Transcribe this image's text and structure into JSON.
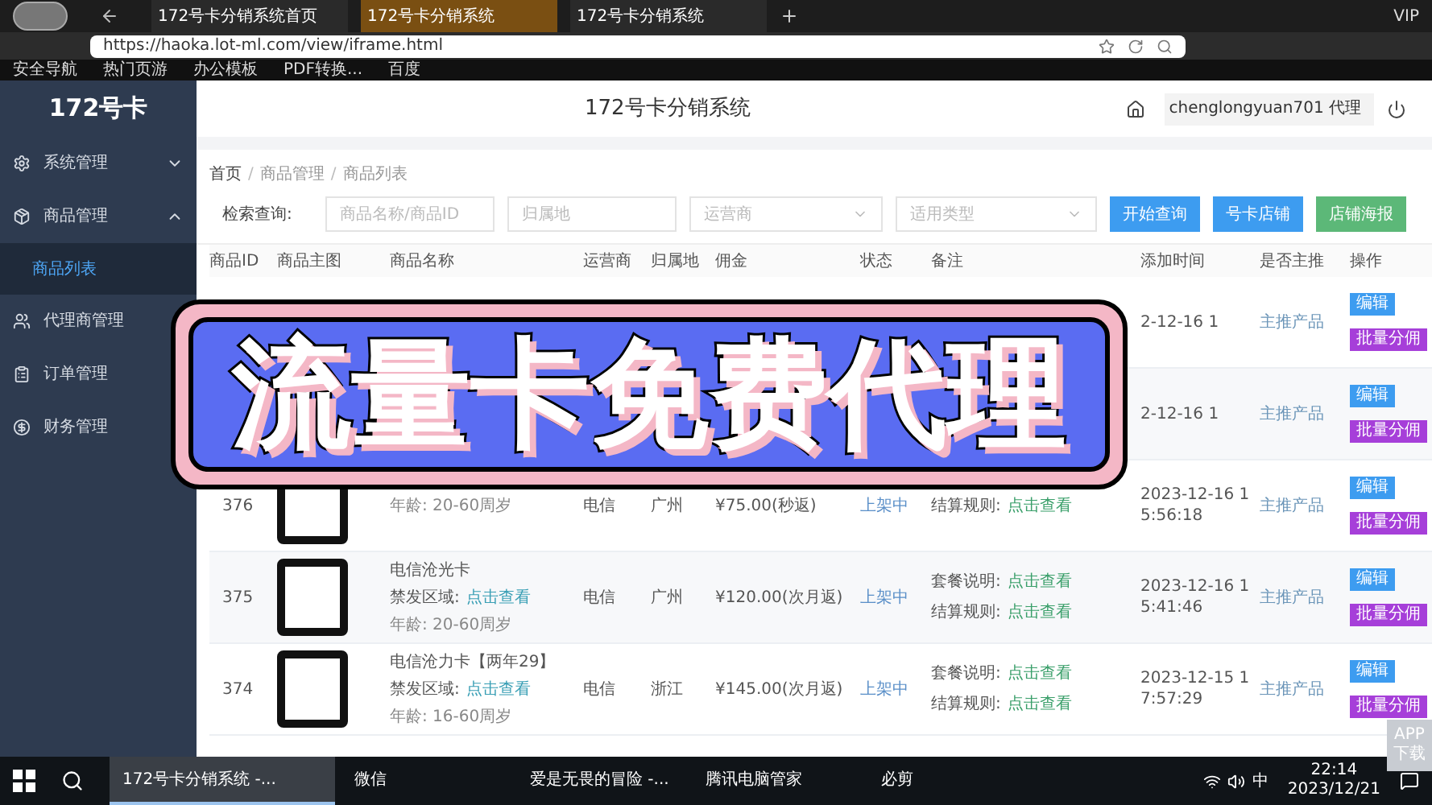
{
  "browser": {
    "tabs": [
      {
        "label": "172号卡分销系统首页",
        "selected": false
      },
      {
        "label": "172号卡分销系统",
        "selected": true
      },
      {
        "label": "172号卡分销系统",
        "selected": false
      }
    ],
    "vip": "VIP",
    "url": "https://haoka.lot-ml.com/view/iframe.html",
    "bookmarks": [
      "安全导航",
      "热门页游",
      "办公模板",
      "PDF转换...",
      "百度"
    ]
  },
  "app": {
    "logo": "172号卡",
    "title": "172号卡分销系统",
    "user": "chenglongyuan701 代理",
    "sidebar": [
      {
        "label": "系统管理",
        "expanded": false
      },
      {
        "label": "商品管理",
        "expanded": true,
        "children": [
          {
            "label": "商品列表",
            "selected": true
          }
        ]
      },
      {
        "label": "代理商管理"
      },
      {
        "label": "订单管理"
      },
      {
        "label": "财务管理"
      }
    ],
    "breadcrumb": [
      "首页",
      "商品管理",
      "商品列表"
    ],
    "breadcrumb_separator": "/",
    "search": {
      "label": "检索查询:",
      "fields": [
        {
          "kind": "input",
          "placeholder": "商品名称/商品ID"
        },
        {
          "kind": "input",
          "placeholder": "归属地"
        },
        {
          "kind": "select",
          "placeholder": "运营商"
        },
        {
          "kind": "select",
          "placeholder": "适用类型"
        }
      ],
      "buttons": [
        {
          "label": "开始查询",
          "color": "#3d9cf0"
        },
        {
          "label": "号卡店铺",
          "color": "#3d9cf0"
        },
        {
          "label": "店铺海报",
          "color": "#5cb878"
        }
      ]
    },
    "table": {
      "columns": [
        "商品ID",
        "商品主图",
        "商品名称",
        "运营商",
        "归属地",
        "佣金",
        "状态",
        "备注",
        "添加时间",
        "是否主推",
        "操作"
      ],
      "rows": [
        {
          "time": "2-12-16 1",
          "featured": "主推产品",
          "actions": [
            "编辑",
            "批量分佣"
          ]
        },
        {
          "time": "2-12-16 1",
          "featured": "主推产品",
          "actions": [
            "编辑",
            "批量分佣"
          ]
        },
        {
          "id": "376",
          "name": {
            "age": "年龄: 20-60周岁"
          },
          "carrier": "电信",
          "region": "广州",
          "commission": "¥75.00(秒返)",
          "status": "上架中",
          "remarks": [
            {
              "label": "结算规则:",
              "link": "点击查看"
            }
          ],
          "time": "2023-12-16 15:56:18",
          "featured": "主推产品",
          "actions": [
            "编辑",
            "批量分佣"
          ]
        },
        {
          "id": "375",
          "name": {
            "title": "电信沧光卡",
            "restrict_label": "禁发区域:",
            "restrict_link": "点击查看",
            "age": "年龄: 20-60周岁"
          },
          "carrier": "电信",
          "region": "广州",
          "commission": "¥120.00(次月返)",
          "status": "上架中",
          "remarks": [
            {
              "label": "套餐说明:",
              "link": "点击查看"
            },
            {
              "label": "结算规则:",
              "link": "点击查看"
            }
          ],
          "time": "2023-12-16 15:41:46",
          "featured": "主推产品",
          "actions": [
            "编辑",
            "批量分佣"
          ]
        },
        {
          "id": "374",
          "name": {
            "title": "电信沧力卡【两年29】",
            "restrict_label": "禁发区域:",
            "restrict_link": "点击查看",
            "age": "年龄: 16-60周岁"
          },
          "carrier": "电信",
          "region": "浙江",
          "commission": "¥145.00(次月返)",
          "status": "上架中",
          "remarks": [
            {
              "label": "套餐说明:",
              "link": "点击查看"
            },
            {
              "label": "结算规则:",
              "link": "点击查看"
            }
          ],
          "time": "2023-12-15 17:57:29",
          "featured": "主推产品",
          "actions": [
            "编辑",
            "批量分佣"
          ]
        }
      ]
    },
    "app_download": "APP下载"
  },
  "banner": {
    "title": "流量卡免费代理"
  },
  "taskbar": {
    "items": [
      {
        "label": "172号卡分销系统 -...",
        "selected": true
      },
      {
        "label": "微信",
        "selected": false
      },
      {
        "label": "爱是无畏的冒险 -...",
        "selected": false
      },
      {
        "label": "腾讯电脑管家",
        "selected": false
      },
      {
        "label": "必剪",
        "selected": false
      }
    ],
    "ime": "中",
    "time": "22:14",
    "date": "2023/12/21"
  }
}
